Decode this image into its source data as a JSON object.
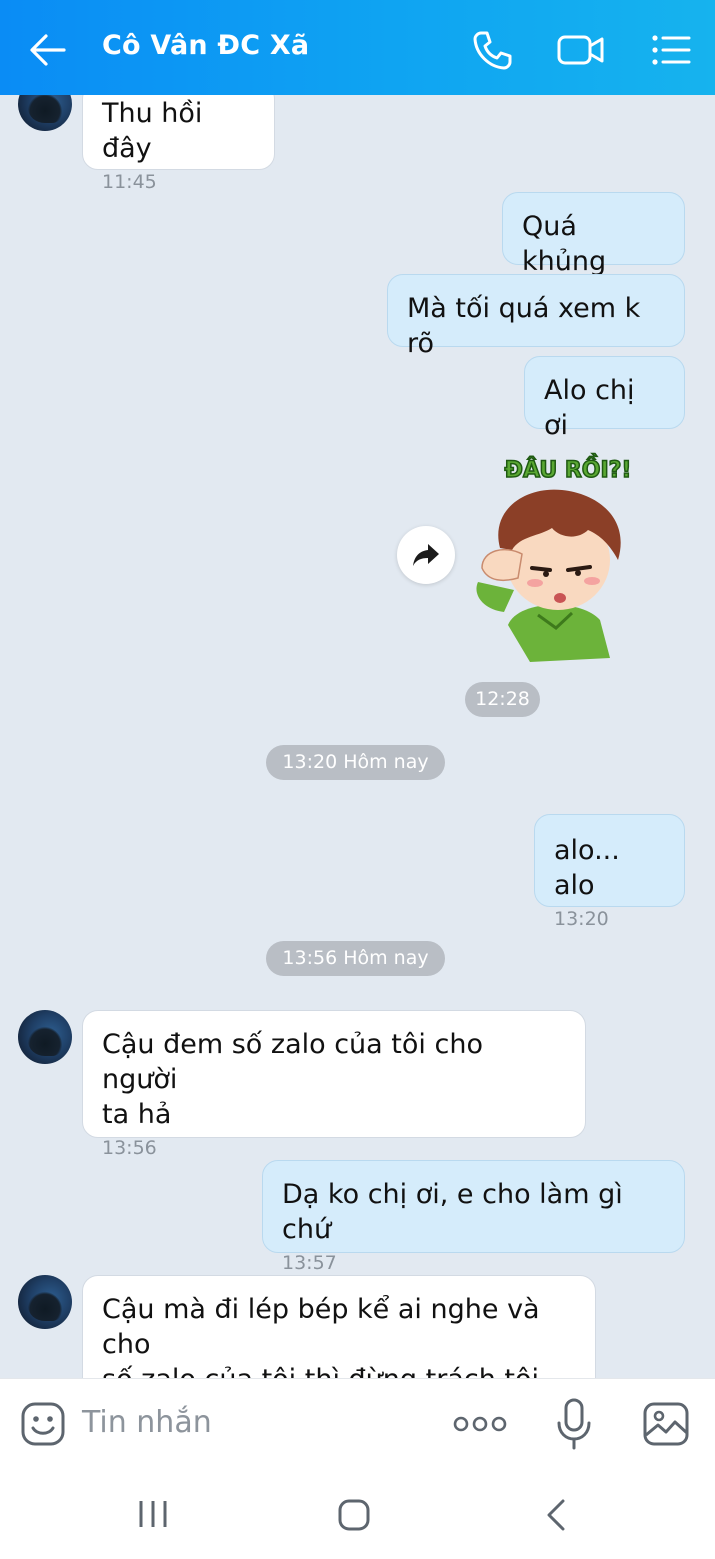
{
  "header": {
    "title": "Cô Vân ĐC Xã",
    "accent_color": "#0fa4f2",
    "icons": [
      "back-arrow-icon",
      "phone-icon",
      "video-call-icon",
      "menu-list-icon"
    ]
  },
  "messages": [
    {
      "side": "in",
      "text": "Thu hồi đây",
      "time": "11:45"
    },
    {
      "side": "out",
      "text": "Quá khủng"
    },
    {
      "side": "out",
      "text": "Mà tối quá xem k rõ"
    },
    {
      "side": "out",
      "text": "Alo chị ơi"
    },
    {
      "side": "out",
      "sticker_caption": "ĐÂU RỒI?!",
      "time": "12:28"
    },
    {
      "side": "out",
      "text": "alo... alo",
      "time": "13:20"
    },
    {
      "side": "in",
      "text_line1": "Cậu đem số zalo của tôi cho người",
      "text_line2": "ta hả",
      "time": "13:56"
    },
    {
      "side": "out",
      "text": "Dạ ko chị ơi, e cho làm gì chứ",
      "time": "13:57"
    },
    {
      "side": "in",
      "text_line1": "Cậu mà đi lép bép kể ai nghe và cho",
      "text_line2": "số zalo của tôi thì đừng trách tôi"
    }
  ],
  "separators": [
    {
      "text": "13:20 Hôm nay"
    },
    {
      "text": "13:56 Hôm nay"
    }
  ],
  "input": {
    "placeholder": "Tin nhắn",
    "icons": [
      "emoji-icon",
      "more-options-icon",
      "microphone-icon",
      "image-icon"
    ]
  },
  "navigation": [
    "recent-apps-icon",
    "home-icon",
    "back-icon"
  ]
}
